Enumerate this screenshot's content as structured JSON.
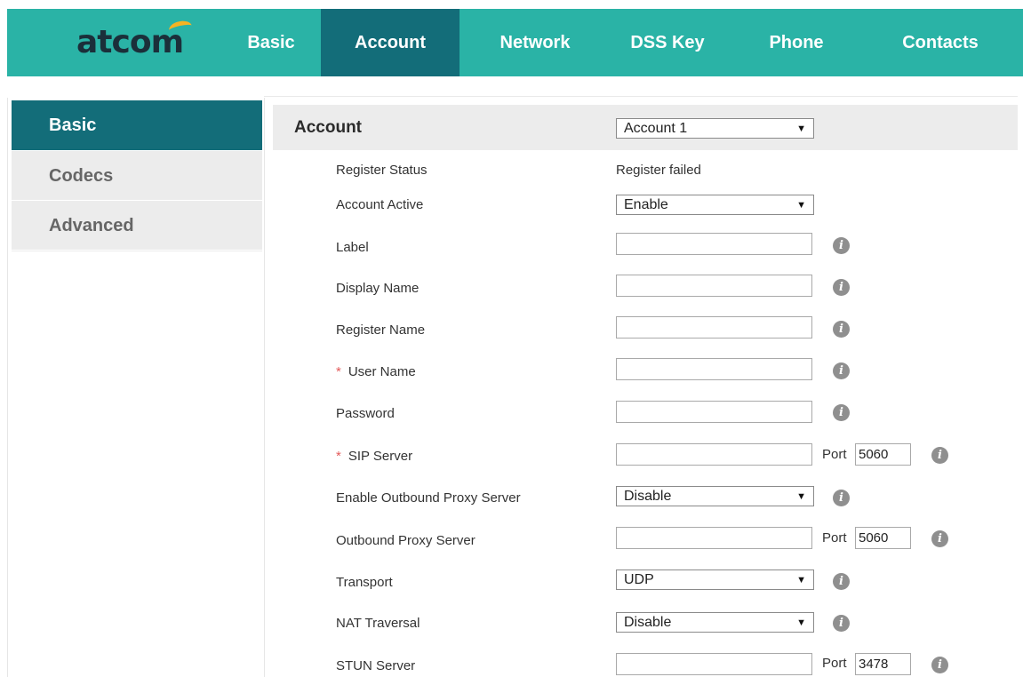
{
  "brand": {
    "logo_text": "atcom"
  },
  "nav": {
    "tabs": [
      {
        "label": "Basic",
        "active": false
      },
      {
        "label": "Account",
        "active": true
      },
      {
        "label": "Network",
        "active": false
      },
      {
        "label": "DSS Key",
        "active": false
      },
      {
        "label": "Phone",
        "active": false
      },
      {
        "label": "Contacts",
        "active": false
      }
    ]
  },
  "sidebar": {
    "items": [
      {
        "label": "Basic",
        "active": true
      },
      {
        "label": "Codecs",
        "active": false
      },
      {
        "label": "Advanced",
        "active": false
      }
    ]
  },
  "account": {
    "title": "Account",
    "selected": "Account 1"
  },
  "form": {
    "register_status": {
      "label": "Register Status",
      "value": "Register failed"
    },
    "account_active": {
      "label": "Account Active",
      "value": "Enable"
    },
    "label": {
      "label": "Label",
      "value": ""
    },
    "display_name": {
      "label": "Display Name",
      "value": ""
    },
    "register_name": {
      "label": "Register Name",
      "value": ""
    },
    "user_name": {
      "label": "User Name",
      "value": "",
      "required": "*"
    },
    "password": {
      "label": "Password",
      "value": ""
    },
    "sip_server": {
      "label": "SIP Server",
      "value": "",
      "required": "*",
      "port_label": "Port",
      "port": "5060"
    },
    "enable_outbound_proxy": {
      "label": "Enable Outbound Proxy Server",
      "value": "Disable"
    },
    "outbound_proxy_server": {
      "label": "Outbound Proxy Server",
      "value": "",
      "port_label": "Port",
      "port": "5060"
    },
    "transport": {
      "label": "Transport",
      "value": "UDP"
    },
    "nat_traversal": {
      "label": "NAT Traversal",
      "value": "Disable"
    },
    "stun_server": {
      "label": "STUN Server",
      "value": "",
      "port_label": "Port",
      "port": "3478"
    }
  },
  "icons": {
    "info": "info-icon",
    "dropdown": "dropdown-arrow-icon"
  },
  "symbols": {
    "info_glyph": "i",
    "dropdown_glyph": "▼"
  },
  "colors": {
    "nav_bg": "#2ab3a6",
    "nav_active": "#136d79",
    "sidebar_bg": "#ececec",
    "required": "#e35b5b"
  }
}
